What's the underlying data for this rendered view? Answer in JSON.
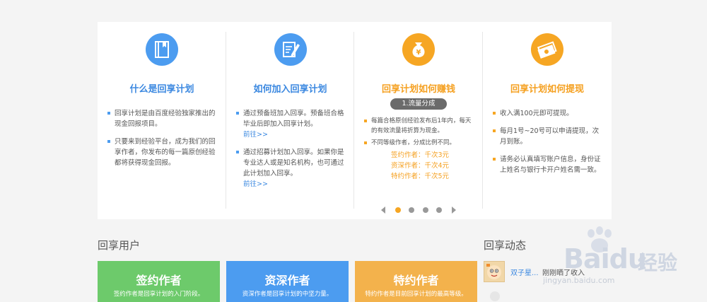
{
  "colors": {
    "blue": "#4c9cf0",
    "orange": "#f6a623",
    "green": "#6dca6b",
    "card_orange": "#f3b24c"
  },
  "columns": [
    {
      "icon": "book-icon",
      "title": "什么是回享计划",
      "items": [
        {
          "text": "回享计划是由百度经验独家推出的现金回报项目。"
        },
        {
          "text": "只要来到经验平台，成为我们的回享作者，你发布的每一篇原创经验都将获得现金回报。"
        }
      ]
    },
    {
      "icon": "edit-icon",
      "title": "如何加入回享计划",
      "items": [
        {
          "text": "通过预备班加入回享。预备班合格毕业后即加入回享计划。",
          "link": "前往>>"
        },
        {
          "text": "通过招募计划加入回享。如果你是专业达人或是知名机构，也可通过此计划加入回享。",
          "link": "前往>>"
        }
      ]
    },
    {
      "icon": "money-bag-icon",
      "title": "回享计划如何赚钱",
      "pill": "1.流量分成",
      "items": [
        {
          "text": "每篇合格原创经验发布后1年内，每天的有效流量将折算为现金。"
        },
        {
          "text": "不同等级作者，分成比例不同。"
        }
      ],
      "tiers": [
        "签约作者：千次3元",
        "资深作者：千次4元",
        "特约作者：千次5元"
      ]
    },
    {
      "icon": "cash-icon",
      "title": "回享计划如何提现",
      "items": [
        {
          "text": "收入满100元即可提现。"
        },
        {
          "text": "每月1号~20号可以申请提现，次月到账。"
        },
        {
          "text": "请务必认真填写账户信息，身份证上姓名与银行卡开户姓名需一致。"
        }
      ]
    }
  ],
  "pager": {
    "dots": 4,
    "active": 0
  },
  "users_section": {
    "title": "回享用户",
    "cards": [
      {
        "title": "签约作者",
        "desc": "签约作者是回享计划的入门阶段。"
      },
      {
        "title": "资深作者",
        "desc": "资深作者是回享计划的中坚力量。"
      },
      {
        "title": "特约作者",
        "desc": "特约作者是目前回享计划的最高等级。"
      }
    ]
  },
  "news_section": {
    "title": "回享动态",
    "feed": [
      {
        "name": "双子星...",
        "action": "刚刚晒了收入"
      }
    ]
  },
  "watermark": {
    "brand": "Baidu",
    "cn": "经验",
    "url": "jingyan.baidu.com"
  }
}
